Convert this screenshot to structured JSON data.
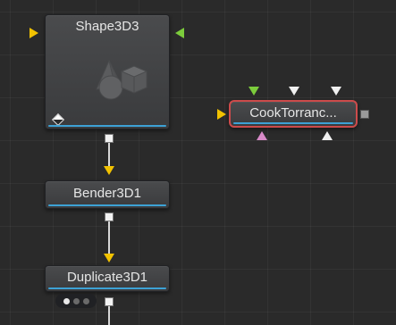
{
  "nodes": {
    "shape3d": {
      "title": "Shape3D3"
    },
    "cooktorrance": {
      "title": "CookTorranc..."
    },
    "bender": {
      "title": "Bender3D1"
    },
    "duplicate": {
      "title": "Duplicate3D1"
    }
  },
  "colors": {
    "background": "#2a2a2a",
    "accent_blue": "#3da2d6",
    "selection_red": "#cc4b4b",
    "input_yellow": "#f2c200",
    "input_green": "#7ccc3c",
    "input_pink": "#d88ac8"
  },
  "icons": {
    "shape3d_thumbnail": "3d-shapes-icon",
    "shape3d_badge": "diamond-icon",
    "duplicate_badge": "three-dots-icon"
  }
}
